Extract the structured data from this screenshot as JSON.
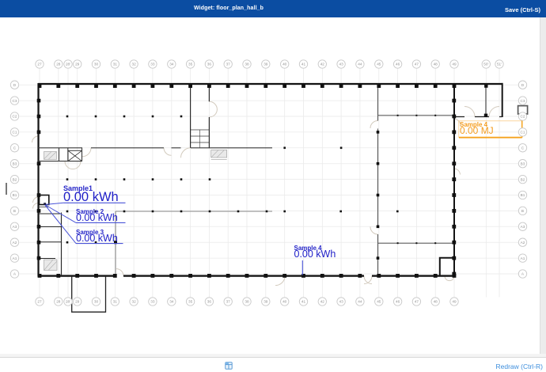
{
  "header": {
    "title": "Widget: floor_plan_hall_b",
    "save_label": "Save (Ctrl-S)"
  },
  "footer": {
    "redraw_label": "Redraw (Ctrl-R)",
    "icon": "table-grid-icon"
  },
  "colors": {
    "header_bg": "#0b4da2",
    "annotation_blue": "#2525c8",
    "annotation_orange": "#f59d20",
    "footer_link": "#3d8edd"
  },
  "grid": {
    "top_labels": [
      "27",
      "28",
      "28'",
      "29",
      "30",
      "31",
      "32",
      "33",
      "34",
      "35",
      "36",
      "37",
      "38",
      "39",
      "40",
      "41",
      "42",
      "43",
      "44",
      "45",
      "46",
      "47",
      "48",
      "49",
      "50'",
      "51'"
    ],
    "bottom_labels": [
      "27",
      "28",
      "28'",
      "29",
      "30",
      "31",
      "32",
      "33",
      "34",
      "35",
      "36",
      "37",
      "38",
      "39",
      "40",
      "41",
      "42",
      "43",
      "44",
      "45",
      "46",
      "47",
      "48",
      "49"
    ],
    "side_labels": [
      "D",
      "C3",
      "C2",
      "C1",
      "C",
      "B3",
      "B2",
      "B1",
      "B",
      "A3",
      "A2",
      "A1",
      "A"
    ]
  },
  "annotations": {
    "sample1": {
      "name": "Sample1",
      "value": "0.00 kWh"
    },
    "sample2": {
      "name": "Sample 2",
      "value": "0.00 kWh"
    },
    "sample3": {
      "name": "Sample 3",
      "value": "0.00 kWh"
    },
    "sample4_kwh": {
      "name": "Sample 4",
      "value": "0.00 kWh"
    },
    "sample4_mj": {
      "name": "Sample 4",
      "value": "0.00 MJ"
    }
  }
}
